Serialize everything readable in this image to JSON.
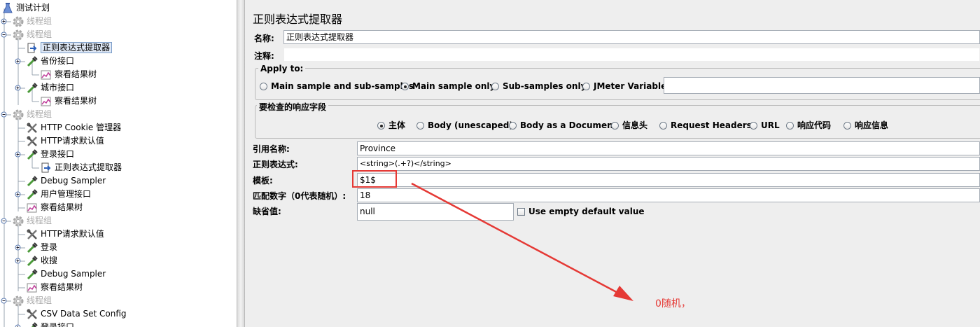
{
  "tree": {
    "nodes": [
      {
        "label": "测试计划",
        "icon": "test-plan-icon",
        "disabled": false,
        "selected": false
      },
      {
        "label": "线程组",
        "icon": "gear-icon",
        "disabled": true,
        "selected": false
      },
      {
        "label": "线程组",
        "icon": "gear-icon",
        "disabled": true,
        "selected": false
      },
      {
        "label": "正则表达式提取器",
        "icon": "extractor-icon",
        "disabled": false,
        "selected": true
      },
      {
        "label": "省份接口",
        "icon": "pipette-icon",
        "disabled": false,
        "selected": false
      },
      {
        "label": "察看结果树",
        "icon": "chart-icon",
        "disabled": false,
        "selected": false
      },
      {
        "label": "城市接口",
        "icon": "pipette-icon",
        "disabled": false,
        "selected": false
      },
      {
        "label": "察看结果树",
        "icon": "chart-icon",
        "disabled": false,
        "selected": false
      },
      {
        "label": "线程组",
        "icon": "gear-icon",
        "disabled": true,
        "selected": false
      },
      {
        "label": "HTTP Cookie 管理器",
        "icon": "wrench-icon",
        "disabled": false,
        "selected": false
      },
      {
        "label": "HTTP请求默认值",
        "icon": "wrench-icon",
        "disabled": false,
        "selected": false
      },
      {
        "label": "登录接口",
        "icon": "pipette-icon",
        "disabled": false,
        "selected": false
      },
      {
        "label": "正则表达式提取器",
        "icon": "extractor-icon",
        "disabled": false,
        "selected": false
      },
      {
        "label": "Debug Sampler",
        "icon": "pipette-icon",
        "disabled": false,
        "selected": false
      },
      {
        "label": "用户管理接口",
        "icon": "pipette-icon",
        "disabled": false,
        "selected": false
      },
      {
        "label": "察看结果树",
        "icon": "chart-icon",
        "disabled": false,
        "selected": false
      },
      {
        "label": "线程组",
        "icon": "gear-icon",
        "disabled": true,
        "selected": false
      },
      {
        "label": "HTTP请求默认值",
        "icon": "wrench-icon",
        "disabled": false,
        "selected": false
      },
      {
        "label": "登录",
        "icon": "pipette-icon",
        "disabled": false,
        "selected": false
      },
      {
        "label": "收搜",
        "icon": "pipette-icon",
        "disabled": false,
        "selected": false
      },
      {
        "label": "Debug Sampler",
        "icon": "pipette-icon",
        "disabled": false,
        "selected": false
      },
      {
        "label": "察看结果树",
        "icon": "chart-icon",
        "disabled": false,
        "selected": false
      },
      {
        "label": "线程组",
        "icon": "gear-icon",
        "disabled": true,
        "selected": false
      },
      {
        "label": "CSV Data Set Config",
        "icon": "wrench-icon",
        "disabled": false,
        "selected": false
      },
      {
        "label": "登录接口",
        "icon": "pipette-icon",
        "disabled": false,
        "selected": false
      }
    ]
  },
  "panel": {
    "title": "正则表达式提取器",
    "name_label": "名称:",
    "name_value": "正则表达式提取器",
    "comment_label": "注释:",
    "comment_value": "",
    "apply_to": {
      "legend": "Apply to:",
      "options": [
        "Main sample and sub-samples",
        "Main sample only",
        "Sub-samples only",
        "JMeter Variable"
      ],
      "selected": "Main sample only",
      "variable_value": ""
    },
    "field_to_check": {
      "legend": "要检查的响应字段",
      "options": [
        "主体",
        "Body (unescaped)",
        "Body as a Document",
        "信息头",
        "Request Headers",
        "URL",
        "响应代码",
        "响应信息"
      ],
      "selected": "主体"
    },
    "ref_name_label": "引用名称:",
    "ref_name_value": "Province",
    "regex_label": "正则表达式:",
    "regex_value": "<string>(.+?)</string>",
    "template_label": "模板:",
    "template_value": "$1$",
    "match_no_label": "匹配数字（0代表随机）:",
    "match_no_value": "18",
    "default_label": "缺省值:",
    "default_value": "null",
    "empty_default_label": "Use empty default value",
    "empty_default_checked": false
  },
  "annotation": {
    "text": "0随机，",
    "color": "#e53935"
  }
}
